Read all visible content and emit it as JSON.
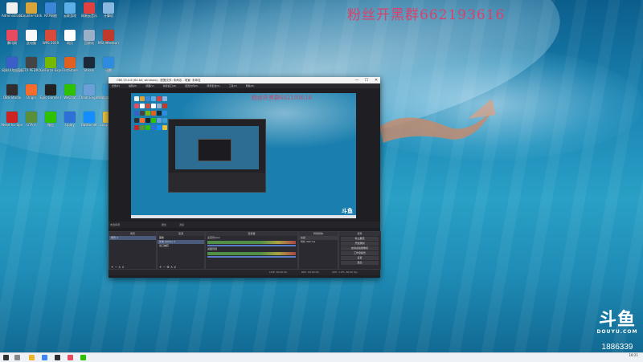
{
  "watermark": "粉丝开黑群662193616",
  "brand": {
    "mark": "斗鱼",
    "name": "DOUYU.COM"
  },
  "room_id": "1886339",
  "desktop_icons": [
    {
      "label": "Administrator",
      "color": "#f0f0f0"
    },
    {
      "label": "Counter-Strike Global Offensive",
      "color": "#d9a53b"
    },
    {
      "label": "NTP网络",
      "color": "#3c86d9"
    },
    {
      "label": "云联游戏",
      "color": "#5bb0e8"
    },
    {
      "label": "网易云音乐",
      "color": "#e04040"
    },
    {
      "label": "计算机",
      "color": "#88b8e0"
    },
    {
      "label": "腾讯网",
      "color": "#e84a5f"
    },
    {
      "label": "此电脑",
      "color": "#fafafa"
    },
    {
      "label": "WPS 2019",
      "color": "#d84a3a"
    },
    {
      "label": "网页",
      "color": "#ffffff"
    },
    {
      "label": "回收站",
      "color": "#9ab0c8"
    },
    {
      "label": "MSI Afterburner",
      "color": "#c0392b"
    },
    {
      "label": "网易UU加速器",
      "color": "#3a5fc8"
    },
    {
      "label": "GTX PEDRO",
      "color": "#444444"
    },
    {
      "label": "GeForce Experience",
      "color": "#76b900"
    },
    {
      "label": "FastStone",
      "color": "#e06020"
    },
    {
      "label": "Steam",
      "color": "#1b2838"
    },
    {
      "label": "迅雷",
      "color": "#2d8be0"
    },
    {
      "label": "OBS Studio",
      "color": "#302e31"
    },
    {
      "label": "Origin",
      "color": "#f56c2d"
    },
    {
      "label": "Epic Games Launcher",
      "color": "#222222"
    },
    {
      "label": "WeChat",
      "color": "#2dc100"
    },
    {
      "label": "Cheat Engine",
      "color": "#6a9fd8"
    },
    {
      "label": "Wallpaper Engine",
      "color": "#3a9fd8"
    },
    {
      "label": "Need for Speed",
      "color": "#cc2222"
    },
    {
      "label": "GTA V",
      "color": "#5a8f3a"
    },
    {
      "label": "微信",
      "color": "#2dc100"
    },
    {
      "label": "Uplay",
      "color": "#2e6fd8"
    },
    {
      "label": "Battle.net",
      "color": "#148eff"
    },
    {
      "label": "Loop Hero",
      "color": "#e8c040"
    }
  ],
  "obs": {
    "title": "OBS 25.0.8 (64-bit, windows) - 配置文件: 未命名 - 场景: 未命名",
    "minimize": "—",
    "maximize": "☐",
    "close": "✕",
    "menu": [
      "文件(F)",
      "编辑(E)",
      "视图(V)",
      "停靠窗口(D)",
      "配置文件(P)",
      "场景集合(S)",
      "工具(T)",
      "帮助(H)"
    ],
    "mode_label": "未选择源",
    "properties": "属性",
    "filters": "滤镜",
    "panels": {
      "scenes": {
        "title": "场景",
        "items": [
          "场景 2"
        ]
      },
      "sources": {
        "title": "来源",
        "items": [
          "图像",
          "文本 (GDI+) 2",
          "窗口捕获"
        ]
      },
      "mixer": {
        "title": "混音器",
        "tracks": [
          {
            "name": "麦克风/Aux",
            "value": "0.0 dB"
          },
          {
            "name": "桌面音频",
            "value": "0.0 dB"
          },
          {
            "name": "麦克风/Aux 2",
            "value": "0.0 dB"
          }
        ]
      },
      "transitions": {
        "title": "转场特效",
        "type": "淡出",
        "duration_label": "时长",
        "duration": "300 ms"
      },
      "controls": {
        "title": "控件",
        "buttons": [
          "停止推流",
          "开始录制",
          "启动虚拟摄像机",
          "工作室模式",
          "设置",
          "退出"
        ]
      }
    },
    "status": {
      "live": "LIVE: 00:00:00",
      "rec": "REC: 00:00:00",
      "cpu": "CPU: 1.9%, 60.00 fps"
    }
  },
  "taskbar": {
    "start": "windows-start-icon",
    "apps": [
      "search-icon",
      "task-view-icon",
      "file-explorer-icon",
      "chrome-icon",
      "obs-icon",
      "wechat-icon",
      "douyu-icon"
    ],
    "tray_time": "18:21"
  }
}
